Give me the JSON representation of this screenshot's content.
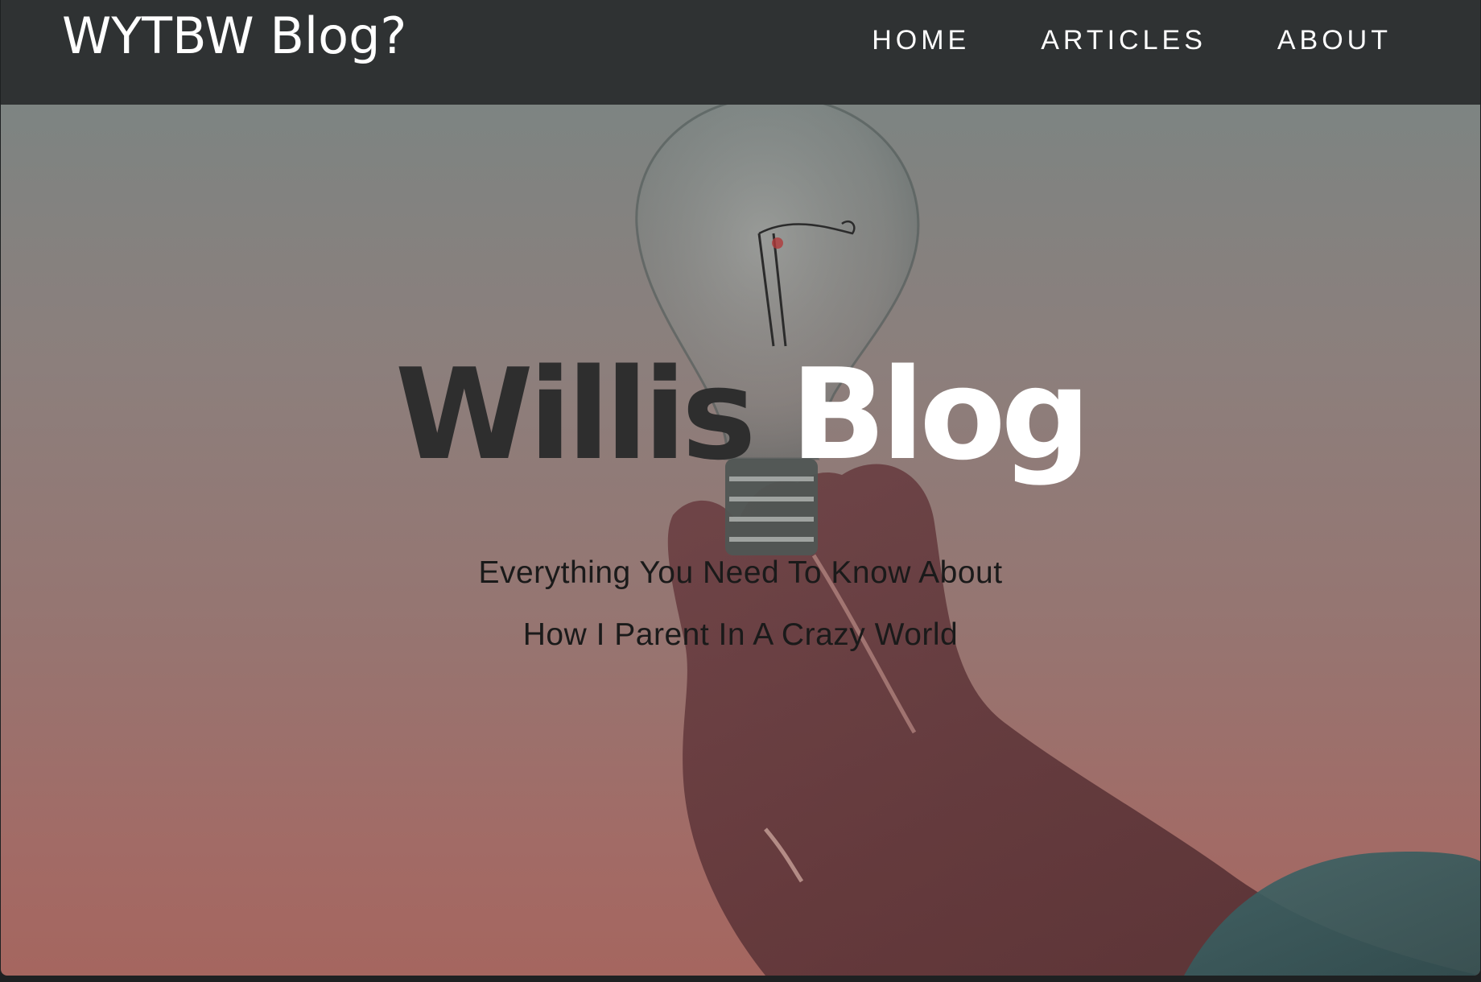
{
  "navbar": {
    "brand": "WYTBW Blog?",
    "links": [
      {
        "label": "HOME"
      },
      {
        "label": "ARTICLES"
      },
      {
        "label": "ABOUT"
      }
    ]
  },
  "hero": {
    "title_part1": "Willis",
    "title_part2": "Blog",
    "subtitle_line1": "Everything You Need To Know About",
    "subtitle_line2": "How I Parent In A Crazy World",
    "image": "hand-holding-light-bulb"
  },
  "colors": {
    "navbar_bg": "#2f3233",
    "title_dark": "#2e2e2e",
    "title_light": "#ffffff",
    "subtitle": "#1a1a1a"
  }
}
